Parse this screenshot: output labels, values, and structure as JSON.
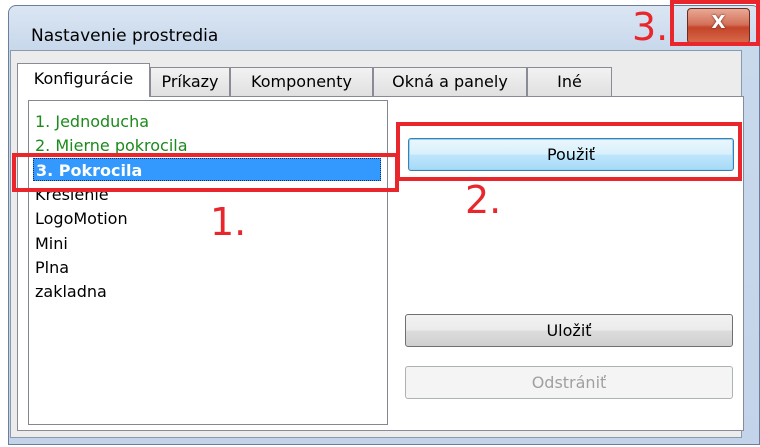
{
  "window": {
    "title": "Nastavenie prostredia",
    "close_label": "X"
  },
  "tabs": [
    {
      "label": "Konfigurácie",
      "active": true
    },
    {
      "label": "Príkazy"
    },
    {
      "label": "Komponenty"
    },
    {
      "label": "Okná a panely"
    },
    {
      "label": "Iné"
    }
  ],
  "configurations": [
    {
      "label": "1. Jednoducha",
      "color": "#1c8a1c"
    },
    {
      "label": "2. Mierne pokrocila",
      "color": "#1c8a1c"
    },
    {
      "label": "3. Pokrocila",
      "selected": true
    },
    {
      "label": "Kreslenie"
    },
    {
      "label": "LogoMotion"
    },
    {
      "label": "Mini"
    },
    {
      "label": "Plna"
    },
    {
      "label": "zakladna"
    }
  ],
  "buttons": {
    "apply": "Použiť",
    "save": "Uložiť",
    "delete": "Odstrániť"
  },
  "annotations": [
    "1.",
    "2.",
    "3."
  ],
  "colors": {
    "annotation": "#e8262b",
    "selection": "#3399ff"
  }
}
